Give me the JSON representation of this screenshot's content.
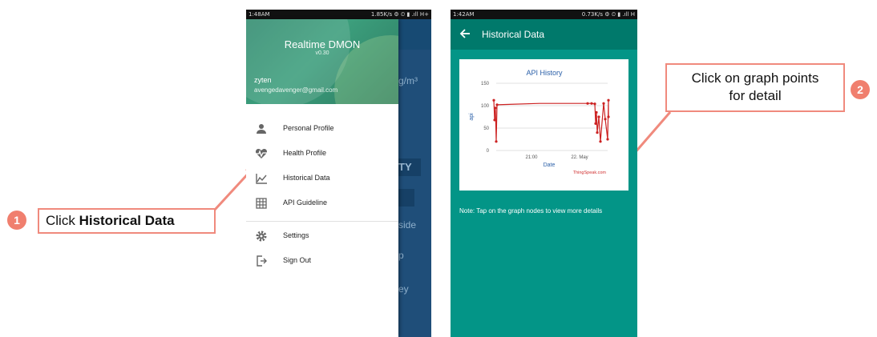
{
  "phone1": {
    "status": {
      "time": "1:48AM",
      "right": "1.85K/s ⚙ ⏲ ▮ .ıll H+"
    },
    "background": {
      "unit": "g/m³",
      "box1": "TY",
      "text1": "side",
      "text2": "p",
      "text3": "ey"
    },
    "drawer": {
      "app_title": "Realtime DMON",
      "app_version": "v0.30",
      "user_name": "zyten",
      "user_email": "avengedavenger@gmail.com",
      "items": [
        {
          "label": "Personal Profile",
          "icon": "person-icon"
        },
        {
          "label": "Health Profile",
          "icon": "heartbeat-icon"
        },
        {
          "label": "Historical Data",
          "icon": "chart-line-icon"
        },
        {
          "label": "API Guideline",
          "icon": "grid-icon"
        },
        {
          "label": "Settings",
          "icon": "gear-icon"
        },
        {
          "label": "Sign Out",
          "icon": "sign-out-icon"
        }
      ]
    }
  },
  "phone2": {
    "status": {
      "time": "1:42AM",
      "right": "0.73K/s ⚙ ⏲ ▮ .ıll H"
    },
    "appbar_title": "Historical Data",
    "note": "Note: Tap on the graph nodes to view more details"
  },
  "callouts": {
    "one": {
      "number": "1",
      "prefix": "Click ",
      "bold": "Historical Data"
    },
    "two": {
      "number": "2",
      "line1": "Click on graph points",
      "line2": "for detail"
    }
  },
  "colors": {
    "accent": "#f07f6e",
    "drawer_header": "#3c9e7c",
    "teal": "#039587",
    "line": "#cc2222"
  },
  "chart_data": {
    "type": "line",
    "title": "API History",
    "xlabel": "Date",
    "ylabel": "api",
    "ylim": [
      0,
      150
    ],
    "yticks": [
      0,
      50,
      100,
      150
    ],
    "xticks": [
      "21:00",
      "22. May"
    ],
    "credit": "ThingSpeak.com",
    "series": [
      {
        "values": [
          112,
          68,
          95,
          20,
          102,
          105,
          105,
          105,
          105,
          105,
          104,
          60,
          85,
          40,
          75,
          20,
          105,
          70,
          25,
          112,
          75
        ]
      }
    ]
  }
}
